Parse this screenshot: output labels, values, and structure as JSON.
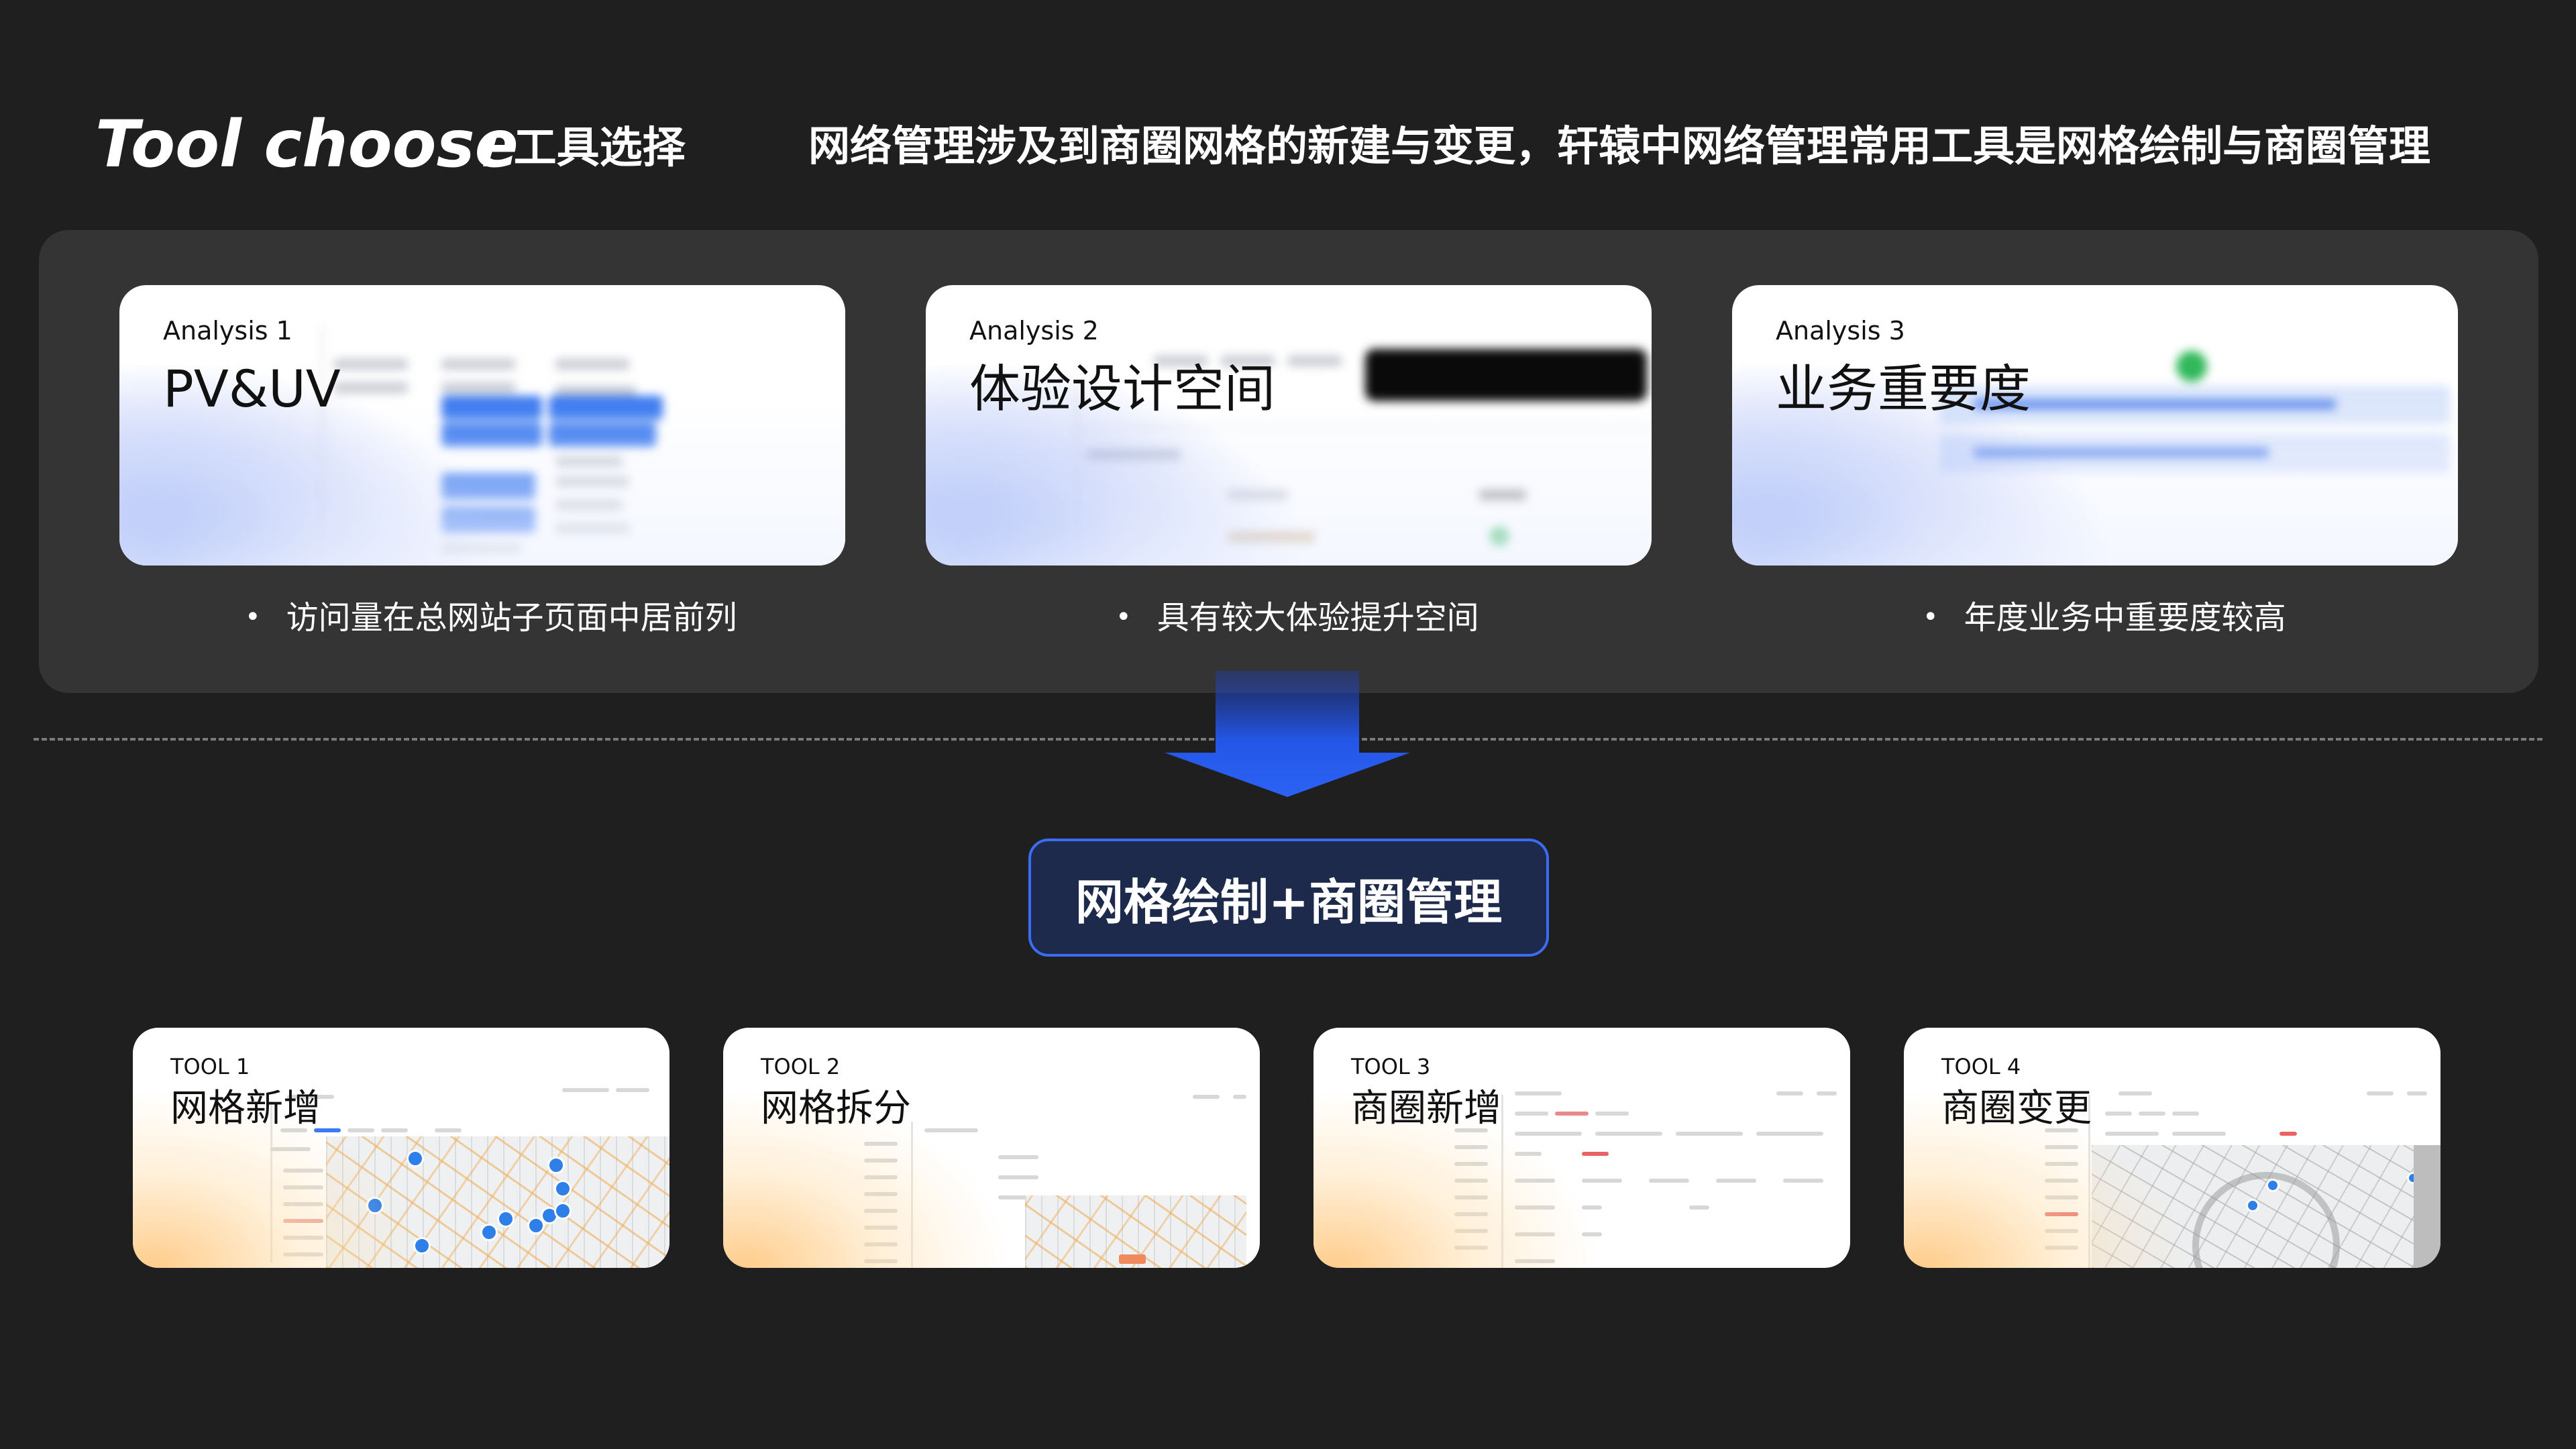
{
  "header": {
    "title": "Tool choose",
    "subtitle": "/ 工具选择",
    "description": "网络管理涉及到商圈网格的新建与变更，轩辕中网络管理常用工具是网格绘制与商圈管理"
  },
  "analyses": [
    {
      "kicker": "Analysis 1",
      "title": "PV&UV",
      "bullet": "访问量在总网站子页面中居前列"
    },
    {
      "kicker": "Analysis 2",
      "title": "体验设计空间",
      "bullet": "具有较大体验提升空间"
    },
    {
      "kicker": "Analysis 3",
      "title": "业务重要度",
      "bullet": "年度业务中重要度较高"
    }
  ],
  "merged_tool": "网格绘制+商圈管理",
  "tools": [
    {
      "kicker": "TOOL 1",
      "title": "网格新增"
    },
    {
      "kicker": "TOOL 2",
      "title": "网格拆分"
    },
    {
      "kicker": "TOOL 3",
      "title": "商圈新增"
    },
    {
      "kicker": "TOOL 4",
      "title": "商圈变更"
    }
  ],
  "colors": {
    "background": "#1f1f1f",
    "panel": "#343434",
    "accent_blue": "#3b6cf3",
    "pill_fill": "#1e2a4b",
    "card_blue_glow": "#466eeb",
    "card_warm_glow": "#ffc478"
  },
  "icons": {
    "bullet": "dot-icon",
    "arrow": "down-arrow-icon"
  }
}
